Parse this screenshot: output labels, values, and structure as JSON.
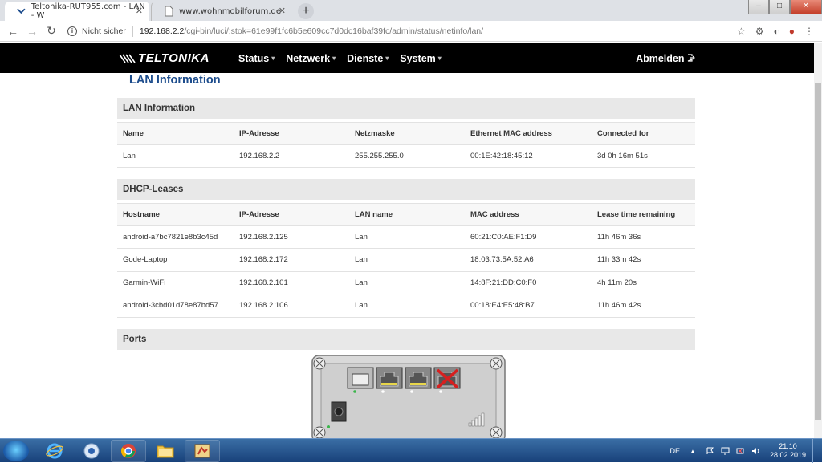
{
  "browser": {
    "tabs": [
      {
        "title": "Teltonika-RUT955.com - LAN - W",
        "active": true
      },
      {
        "title": "www.wohnmobilforum.de",
        "active": false
      }
    ],
    "security_label": "Nicht sicher",
    "url_host": "192.168.2.2",
    "url_path": "/cgi-bin/luci/;stok=61e99f1fc6b5e609cc7d0dc16baf39fc/admin/status/netinfo/lan/"
  },
  "app": {
    "logo_text": "TELTONIKA",
    "nav": [
      "Status",
      "Netzwerk",
      "Dienste",
      "System"
    ],
    "logout_label": "Abmelden"
  },
  "page": {
    "title": "LAN Information",
    "lan_section": {
      "title": "LAN Information",
      "columns": [
        "Name",
        "IP-Adresse",
        "Netzmaske",
        "Ethernet MAC address",
        "Connected for"
      ],
      "rows": [
        [
          "Lan",
          "192.168.2.2",
          "255.255.255.0",
          "00:1E:42:18:45:12",
          "3d 0h 16m 51s"
        ]
      ]
    },
    "dhcp_section": {
      "title": "DHCP-Leases",
      "columns": [
        "Hostname",
        "IP-Adresse",
        "LAN name",
        "MAC address",
        "Lease time remaining"
      ],
      "rows": [
        [
          "android-a7bc7821e8b3c45d",
          "192.168.2.125",
          "Lan",
          "60:21:C0:AE:F1:D9",
          "11h 46m 36s"
        ],
        [
          "Gode-Laptop",
          "192.168.2.172",
          "Lan",
          "18:03:73:5A:52:A6",
          "11h 33m 42s"
        ],
        [
          "Garmin-WiFi",
          "192.168.2.101",
          "Lan",
          "14:8F:21:DD:C0:F0",
          "4h 11m 20s"
        ],
        [
          "android-3cbd01d78e87bd57",
          "192.168.2.106",
          "Lan",
          "00:18:E4:E5:48:B7",
          "11h 46m 42s"
        ]
      ]
    },
    "ports_section": {
      "title": "Ports"
    }
  },
  "taskbar": {
    "language": "DE",
    "time": "21:10",
    "date": "28.02.2019"
  }
}
